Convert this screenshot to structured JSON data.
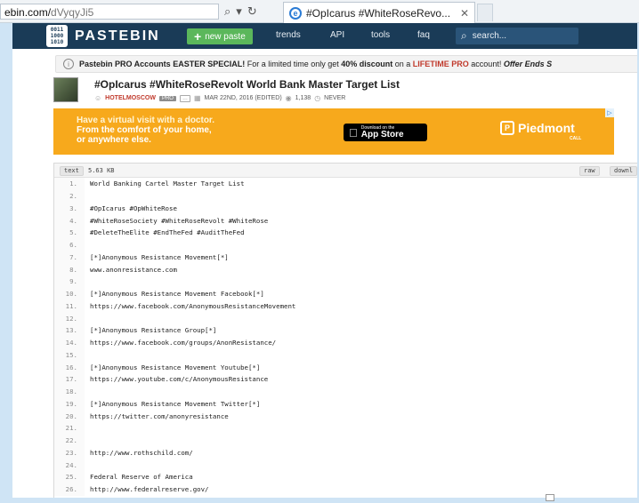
{
  "browser": {
    "url_domain": "ebin.com/",
    "url_path": "dVyqyJi5",
    "tab_title": "#OpIcarus #WhiteRoseRevo...",
    "tab_close": "✕"
  },
  "header": {
    "logo_text": "PASTEBIN",
    "logo_icon_text": "0011 1000 1010",
    "new_paste_label": "new paste",
    "nav": [
      "trends",
      "API",
      "tools",
      "faq"
    ],
    "search_placeholder": "search..."
  },
  "banner": {
    "part1": "Pastebin PRO Accounts EASTER SPECIAL!",
    "part2": " For a limited time only get ",
    "part3": "40% discount",
    "part4": " on a ",
    "part5": "LIFETIME PRO",
    "part6": " account! ",
    "part7": "Offer Ends S"
  },
  "paste": {
    "title": "#OpIcarus #WhiteRoseRevolt World Bank Master Target List",
    "user": "HOTELMOSCOW",
    "badge_pro": "PRO",
    "date": "MAR 22ND, 2016 (EDITED)",
    "views": "1,138",
    "expiry": "NEVER"
  },
  "ad": {
    "line1": "Have a virtual visit with a doctor.",
    "line2": "From the comfort of your home,",
    "line3": "or anywhere else.",
    "appstore_small": "Download on the",
    "appstore_big": "App Store",
    "brand": "Piedmont",
    "brand_sub": "CALL"
  },
  "code": {
    "syntax": "text",
    "size": "5.63 KB",
    "raw_label": "raw",
    "download_label": "downl",
    "lines": [
      {
        "n": "1.",
        "t": "World Banking Cartel Master Target List"
      },
      {
        "n": "2.",
        "t": ""
      },
      {
        "n": "3.",
        "t": "#OpIcarus #OpWhiteRose"
      },
      {
        "n": "4.",
        "t": "#WhiteRoseSociety #WhiteRoseRevolt #WhiteRose"
      },
      {
        "n": "5.",
        "t": "#DeleteTheElite #EndTheFed #AuditTheFed"
      },
      {
        "n": "6.",
        "t": ""
      },
      {
        "n": "7.",
        "t": "[*]Anonymous Resistance Movement[*]"
      },
      {
        "n": "8.",
        "t": "www.anonresistance.com"
      },
      {
        "n": "9.",
        "t": ""
      },
      {
        "n": "10.",
        "t": "[*]Anonymous Resistance Movement Facebook[*]"
      },
      {
        "n": "11.",
        "t": "https://www.facebook.com/AnonymousResistanceMovement"
      },
      {
        "n": "12.",
        "t": ""
      },
      {
        "n": "13.",
        "t": "[*]Anonymous Resistance Group[*]"
      },
      {
        "n": "14.",
        "t": "https://www.facebook.com/groups/AnonResistance/"
      },
      {
        "n": "15.",
        "t": ""
      },
      {
        "n": "16.",
        "t": "[*]Anonymous Resistance Movement Youtube[*]"
      },
      {
        "n": "17.",
        "t": "https://www.youtube.com/c/AnonymousResistance"
      },
      {
        "n": "18.",
        "t": ""
      },
      {
        "n": "19.",
        "t": "[*]Anonymous Resistance Movement Twitter[*]"
      },
      {
        "n": "20.",
        "t": "https://twitter.com/anonyresistance"
      },
      {
        "n": "21.",
        "t": ""
      },
      {
        "n": "22.",
        "t": ""
      },
      {
        "n": "23.",
        "t": "http://www.rothschild.com/"
      },
      {
        "n": "24.",
        "t": ""
      },
      {
        "n": "25.",
        "t": "Federal Reserve of America"
      },
      {
        "n": "26.",
        "t": "http://www.federalreserve.gov/"
      }
    ]
  },
  "colors": {
    "header_bg": "#1a3b57",
    "new_paste_bg": "#5bb75b",
    "ad_bg": "#f7a91c",
    "accent_red": "#c0392b"
  }
}
